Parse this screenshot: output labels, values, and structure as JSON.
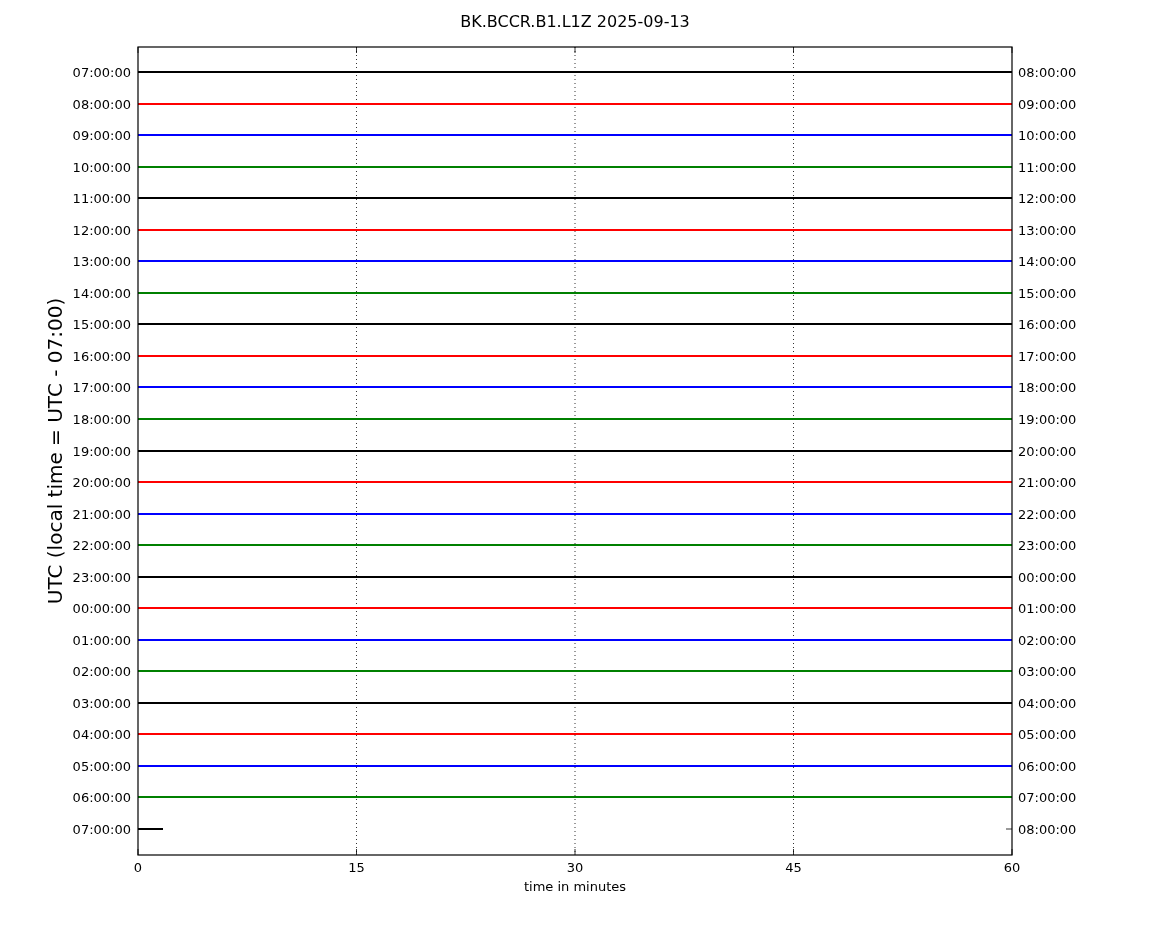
{
  "title": "BK.BCCR.B1.L1Z 2025-09-13",
  "ylabel": "UTC (local time = UTC - 07:00)",
  "xlabel": "time in minutes",
  "xticks": [
    "0",
    "15",
    "30",
    "45",
    "60"
  ],
  "rows": [
    {
      "left": "07:00:00",
      "right": "08:00:00",
      "color": "#000000",
      "kind": "full"
    },
    {
      "left": "08:00:00",
      "right": "09:00:00",
      "color": "#ff0000",
      "kind": "full"
    },
    {
      "left": "09:00:00",
      "right": "10:00:00",
      "color": "#0000ff",
      "kind": "full"
    },
    {
      "left": "10:00:00",
      "right": "11:00:00",
      "color": "#008000",
      "kind": "full"
    },
    {
      "left": "11:00:00",
      "right": "12:00:00",
      "color": "#000000",
      "kind": "full"
    },
    {
      "left": "12:00:00",
      "right": "13:00:00",
      "color": "#ff0000",
      "kind": "full"
    },
    {
      "left": "13:00:00",
      "right": "14:00:00",
      "color": "#0000ff",
      "kind": "full"
    },
    {
      "left": "14:00:00",
      "right": "15:00:00",
      "color": "#008000",
      "kind": "full"
    },
    {
      "left": "15:00:00",
      "right": "16:00:00",
      "color": "#000000",
      "kind": "full"
    },
    {
      "left": "16:00:00",
      "right": "17:00:00",
      "color": "#ff0000",
      "kind": "full"
    },
    {
      "left": "17:00:00",
      "right": "18:00:00",
      "color": "#0000ff",
      "kind": "full"
    },
    {
      "left": "18:00:00",
      "right": "19:00:00",
      "color": "#008000",
      "kind": "full"
    },
    {
      "left": "19:00:00",
      "right": "20:00:00",
      "color": "#000000",
      "kind": "full"
    },
    {
      "left": "20:00:00",
      "right": "21:00:00",
      "color": "#ff0000",
      "kind": "full"
    },
    {
      "left": "21:00:00",
      "right": "22:00:00",
      "color": "#0000ff",
      "kind": "full"
    },
    {
      "left": "22:00:00",
      "right": "23:00:00",
      "color": "#008000",
      "kind": "full"
    },
    {
      "left": "23:00:00",
      "right": "00:00:00",
      "color": "#000000",
      "kind": "full"
    },
    {
      "left": "00:00:00",
      "right": "01:00:00",
      "color": "#ff0000",
      "kind": "full"
    },
    {
      "left": "01:00:00",
      "right": "02:00:00",
      "color": "#0000ff",
      "kind": "full"
    },
    {
      "left": "02:00:00",
      "right": "03:00:00",
      "color": "#008000",
      "kind": "full"
    },
    {
      "left": "03:00:00",
      "right": "04:00:00",
      "color": "#000000",
      "kind": "full"
    },
    {
      "left": "04:00:00",
      "right": "05:00:00",
      "color": "#ff0000",
      "kind": "full"
    },
    {
      "left": "05:00:00",
      "right": "06:00:00",
      "color": "#0000ff",
      "kind": "full"
    },
    {
      "left": "06:00:00",
      "right": "07:00:00",
      "color": "#008000",
      "kind": "full"
    },
    {
      "left": "07:00:00",
      "right": "08:00:00",
      "color": "#000000",
      "kind": "partial"
    }
  ]
}
